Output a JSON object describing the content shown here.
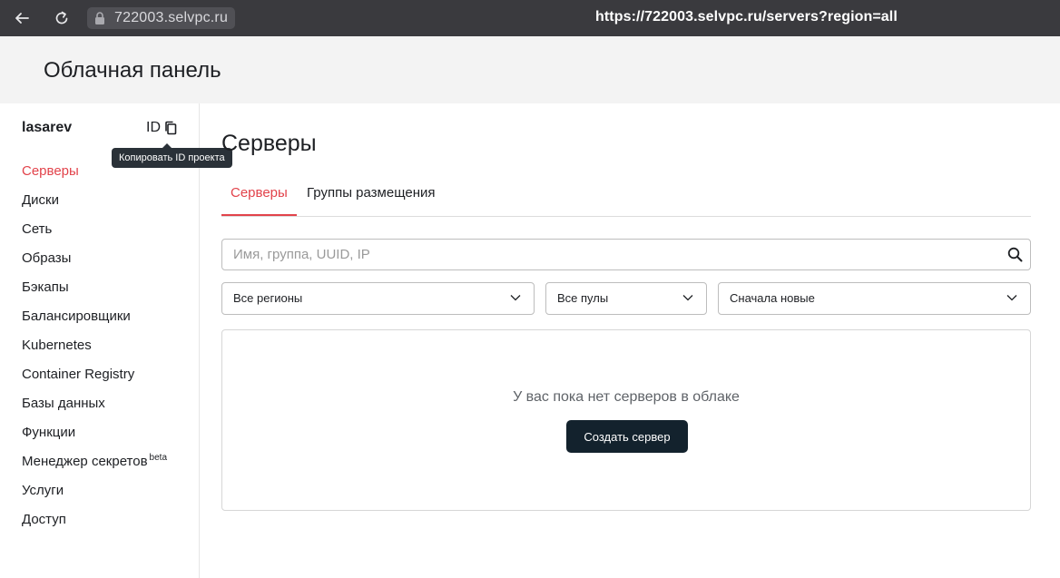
{
  "browser": {
    "domain": "722003.selvpc.ru",
    "url": "https://722003.selvpc.ru/servers?region=all",
    "icons": {
      "back": "arrow-left-icon",
      "reload": "reload-icon",
      "lock": "lock-icon"
    }
  },
  "header": {
    "title": "Облачная панель"
  },
  "sidebar": {
    "project_name": "lasarev",
    "id_label": "ID",
    "copy_tooltip": "Копировать ID проекта",
    "items": [
      {
        "label": "Серверы",
        "active": true
      },
      {
        "label": "Диски"
      },
      {
        "label": "Сеть"
      },
      {
        "label": "Образы"
      },
      {
        "label": "Бэкапы"
      },
      {
        "label": "Балансировщики"
      },
      {
        "label": "Kubernetes"
      },
      {
        "label": "Container Registry"
      },
      {
        "label": "Базы данных"
      },
      {
        "label": "Функции"
      },
      {
        "label": "Менеджер секретов",
        "badge": "beta"
      },
      {
        "label": "Услуги"
      },
      {
        "label": "Доступ"
      }
    ]
  },
  "main": {
    "title": "Серверы",
    "tabs": [
      {
        "label": "Серверы",
        "active": true
      },
      {
        "label": "Группы размещения"
      }
    ],
    "search": {
      "placeholder": "Имя, группа, UUID, IP",
      "value": ""
    },
    "filters": {
      "region": "Все регионы",
      "pool": "Все пулы",
      "sort": "Сначала новые"
    },
    "empty_state": {
      "message": "У вас пока нет серверов в облаке",
      "button": "Создать сервер"
    }
  },
  "colors": {
    "accent": "#e2434b",
    "primary_button": "#13222d",
    "browser_bar": "#3a3a3e",
    "header_bg": "#f3f3f3"
  }
}
